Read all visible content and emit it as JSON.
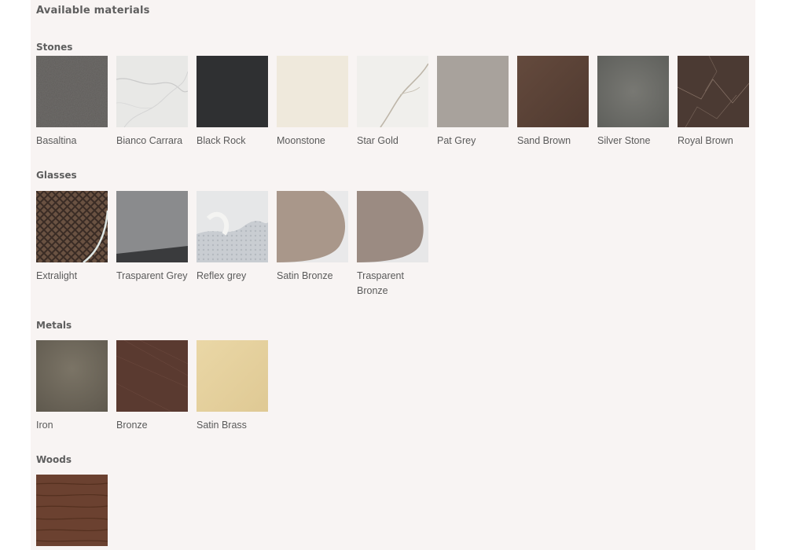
{
  "page": {
    "title": "Available materials"
  },
  "sections": [
    {
      "id": "stones",
      "title": "Stones",
      "items": [
        {
          "label": "Basaltina",
          "color": "#5e5b58"
        },
        {
          "label": "Bianco Carrara",
          "color": "#e8e8e6"
        },
        {
          "label": "Black Rock",
          "color": "#2f3032"
        },
        {
          "label": "Moonstone",
          "color": "#efe9dc"
        },
        {
          "label": "Star Gold",
          "color": "#f0efec"
        },
        {
          "label": "Pat Grey",
          "color": "#a8a29c"
        },
        {
          "label": "Sand Brown",
          "color": "#5a4338"
        },
        {
          "label": "Silver Stone",
          "color": "#6d6e6a"
        },
        {
          "label": "Royal Brown",
          "color": "#4b3a33"
        }
      ]
    },
    {
      "id": "glasses",
      "title": "Glasses",
      "items": [
        {
          "label": "Extralight",
          "color": "#4a3a31"
        },
        {
          "label": "Trasparent Grey",
          "color": "#8a8b8d"
        },
        {
          "label": "Reflex grey",
          "color": "#c9cdd2"
        },
        {
          "label": "Satin Bronze",
          "color": "#a9978a"
        },
        {
          "label": "Trasparent Bronze",
          "color": "#9b8b82"
        }
      ]
    },
    {
      "id": "metals",
      "title": "Metals",
      "items": [
        {
          "label": "Iron",
          "color": "#6d6659"
        },
        {
          "label": "Bronze",
          "color": "#5a3a30"
        },
        {
          "label": "Satin Brass",
          "color": "#e6d2a0"
        }
      ]
    },
    {
      "id": "woods",
      "title": "Woods",
      "items": [
        {
          "label": "",
          "color": "#6b4130"
        }
      ]
    }
  ]
}
